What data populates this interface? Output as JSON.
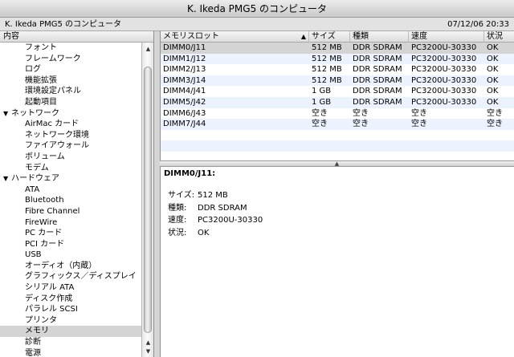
{
  "window": {
    "title": "K. Ikeda PMG5 のコンピュータ"
  },
  "infobar": {
    "left": "K. Ikeda PMG5 のコンピュータ",
    "right": "07/12/06 20:33"
  },
  "sidebar": {
    "header": "内容",
    "items": [
      {
        "label": "フォント",
        "type": "child"
      },
      {
        "label": "フレームワーク",
        "type": "child"
      },
      {
        "label": "ログ",
        "type": "child"
      },
      {
        "label": "機能拡張",
        "type": "child"
      },
      {
        "label": "環境設定パネル",
        "type": "child"
      },
      {
        "label": "起動項目",
        "type": "child"
      },
      {
        "label": "ネットワーク",
        "type": "group"
      },
      {
        "label": "AirMac カード",
        "type": "child"
      },
      {
        "label": "ネットワーク環境",
        "type": "child"
      },
      {
        "label": "ファイアウォール",
        "type": "child"
      },
      {
        "label": "ボリューム",
        "type": "child"
      },
      {
        "label": "モデム",
        "type": "child"
      },
      {
        "label": "ハードウェア",
        "type": "group"
      },
      {
        "label": "ATA",
        "type": "child"
      },
      {
        "label": "Bluetooth",
        "type": "child"
      },
      {
        "label": "Fibre Channel",
        "type": "child"
      },
      {
        "label": "FireWire",
        "type": "child"
      },
      {
        "label": "PC カード",
        "type": "child"
      },
      {
        "label": "PCI カード",
        "type": "child"
      },
      {
        "label": "USB",
        "type": "child"
      },
      {
        "label": "オーディオ（内蔵）",
        "type": "child"
      },
      {
        "label": "グラフィックス／ディスプレイ",
        "type": "child"
      },
      {
        "label": "シリアル ATA",
        "type": "child"
      },
      {
        "label": "ディスク作成",
        "type": "child"
      },
      {
        "label": "パラレル SCSI",
        "type": "child"
      },
      {
        "label": "プリンタ",
        "type": "child"
      },
      {
        "label": "メモリ",
        "type": "child",
        "selected": true
      },
      {
        "label": "診断",
        "type": "child"
      },
      {
        "label": "電源",
        "type": "child"
      }
    ]
  },
  "table": {
    "columns": [
      "メモリスロット",
      "サイズ",
      "種類",
      "速度",
      "状況"
    ],
    "rows": [
      [
        "DIMM0/J11",
        "512 MB",
        "DDR SDRAM",
        "PC3200U-30330",
        "OK"
      ],
      [
        "DIMM1/J12",
        "512 MB",
        "DDR SDRAM",
        "PC3200U-30330",
        "OK"
      ],
      [
        "DIMM2/J13",
        "512 MB",
        "DDR SDRAM",
        "PC3200U-30330",
        "OK"
      ],
      [
        "DIMM3/J14",
        "512 MB",
        "DDR SDRAM",
        "PC3200U-30330",
        "OK"
      ],
      [
        "DIMM4/J41",
        "1 GB",
        "DDR SDRAM",
        "PC3200U-30330",
        "OK"
      ],
      [
        "DIMM5/J42",
        "1 GB",
        "DDR SDRAM",
        "PC3200U-30330",
        "OK"
      ],
      [
        "DIMM6/J43",
        "空き",
        "空き",
        "空き",
        "空き"
      ],
      [
        "DIMM7/J44",
        "空き",
        "空き",
        "空き",
        "空き"
      ]
    ]
  },
  "detail": {
    "title": "DIMM0/J11:",
    "fields": [
      {
        "key": "サイズ:",
        "value": "512 MB"
      },
      {
        "key": "種類:",
        "value": "DDR SDRAM"
      },
      {
        "key": "速度:",
        "value": "PC3200U-30330"
      },
      {
        "key": "状況:",
        "value": "OK"
      }
    ]
  },
  "colors": {
    "selection": "#d4d4d4",
    "stripe": "#edf3fe"
  },
  "icons": {
    "sort": "sort-ascending-icon",
    "disclosure": "disclosure-triangle-icon"
  }
}
